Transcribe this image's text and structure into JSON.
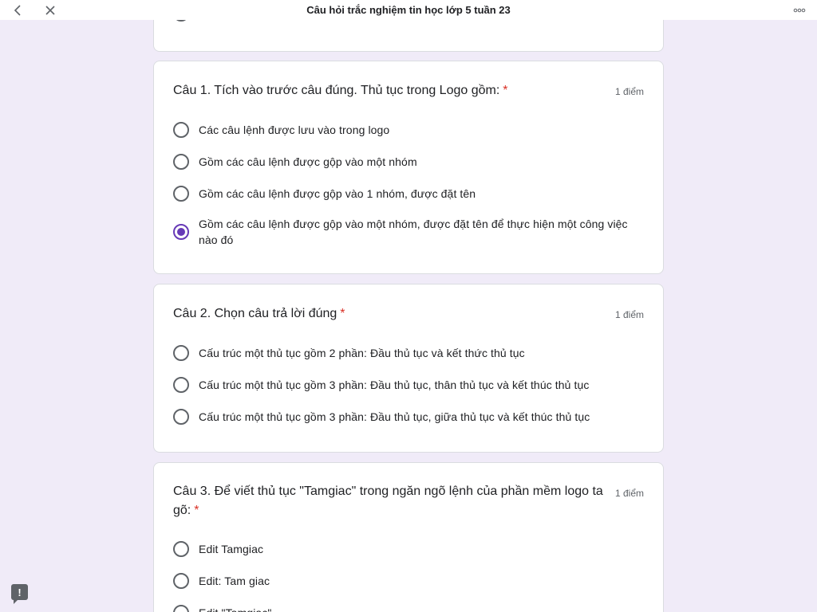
{
  "header": {
    "title": "Câu hỏi trắc nghiệm tin học lớp 5 tuần 23",
    "back_icon": "chevron-left-icon",
    "close_icon": "close-icon",
    "more_icon": "more-horizontal-icon"
  },
  "questions": [
    {
      "title": "Câu 1. Tích vào trước câu đúng. Thủ tục trong Logo gồm:",
      "required_mark": "*",
      "points": "1 điểm",
      "options": [
        {
          "label": "Các câu lệnh được lưu vào trong logo",
          "selected": false
        },
        {
          "label": "Gồm các câu lệnh được gộp vào một nhóm",
          "selected": false
        },
        {
          "label": "Gồm các câu lệnh được gộp vào 1 nhóm, được đặt tên",
          "selected": false
        },
        {
          "label": "Gồm các câu lệnh được gộp vào một nhóm, được đặt tên để thực hiện một công việc nào đó",
          "selected": true
        }
      ]
    },
    {
      "title": "Câu 2. Chọn câu trả lời đúng",
      "required_mark": "*",
      "points": "1 điểm",
      "options": [
        {
          "label": "Cấu trúc một thủ tục gồm 2 phần: Đầu thủ tục và kết thức thủ tục",
          "selected": false
        },
        {
          "label": "Cấu trúc một thủ tục gồm 3 phần: Đầu thủ tục, thân thủ tục và kết thúc thủ tục",
          "selected": false
        },
        {
          "label": "Cấu trúc một thủ tục gồm 3 phần: Đầu thủ tục, giữa thủ tục và kết thúc thủ tục",
          "selected": false
        }
      ]
    },
    {
      "title": "Câu 3. Để viết thủ tục \"Tamgiac\" trong ngăn ngõ lệnh của phần mềm logo ta gõ:",
      "required_mark": "*",
      "points": "1 điểm",
      "options": [
        {
          "label": "Edit Tamgiac",
          "selected": false
        },
        {
          "label": "Edit: Tam giac",
          "selected": false
        },
        {
          "label": "Edit \"Tamgiac\"",
          "selected": false
        }
      ]
    }
  ],
  "feedback": {
    "icon": "report-feedback-icon",
    "glyph": "!"
  },
  "colors": {
    "background": "#f0ebf8",
    "accent": "#673ab7",
    "required": "#d93025"
  }
}
